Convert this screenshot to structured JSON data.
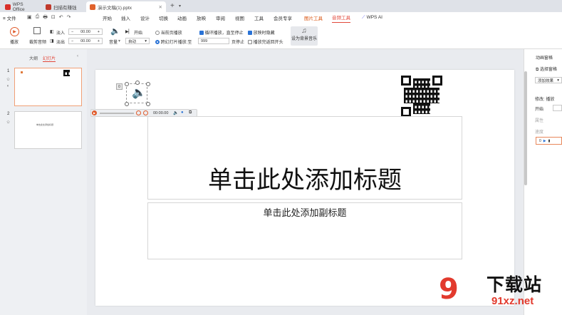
{
  "tabs": [
    {
      "label": "WPS Office",
      "color": "#d9302a"
    },
    {
      "label": "扫描有赚钱",
      "color": "#c0392b"
    },
    {
      "label": "演示文稿(1).pptx",
      "color": "#e0622c"
    }
  ],
  "menus": [
    "≡ 文件",
    "开始",
    "插入",
    "设计",
    "切换",
    "动画",
    "放映",
    "审阅",
    "视图",
    "工具",
    "会员专享",
    "图片工具",
    "音频工具",
    "WPS AI"
  ],
  "toolbar": {
    "play": "播放",
    "cut": "裁剪音频",
    "fade_in": "淡入",
    "fade_out": "淡出",
    "fade_in_value": "00.00",
    "fade_out_value": "00.00",
    "volume": "音量",
    "start_label": "开始",
    "start_value": "自动",
    "current_page": "当前页播放",
    "cross_slides": "跨幻灯片播放:至",
    "slide_count": "999",
    "page_stop": "页停止",
    "loop": "循环播放，直至停止",
    "hide_on_show": "放映时隐藏",
    "rewind": "播放完返回开头",
    "set_bgm": "设为背景音乐"
  },
  "left": {
    "outline": "大纲",
    "slides": "幻灯片",
    "slide_numbers": [
      "1",
      "2"
    ]
  },
  "slide": {
    "title": "单击此处添加标题",
    "subtitle": "单击此处添加副标题",
    "audio_time": "00:00.00",
    "audio_badge": "0"
  },
  "thumb2_text": "单击此处添加标题",
  "right": {
    "anim_pane": "动画窗格",
    "select_pane": "选择窗格",
    "add_effect": "添加效果",
    "modify": "修改: 播放",
    "start": "开始",
    "property": "属性",
    "speed": "速度",
    "item_number": "0"
  },
  "watermark": {
    "brand": "下载站",
    "site": "91xz.net"
  }
}
